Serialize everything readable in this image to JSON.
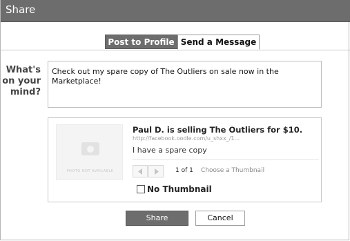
{
  "dialog": {
    "title": "Share"
  },
  "tabs": [
    {
      "label": "Post to Profile",
      "active": true
    },
    {
      "label": "Send a Message",
      "active": false
    }
  ],
  "status": {
    "prompt": "What's on your mind?",
    "text": "Check out my spare copy of The Outliers on sale now in the Marketplace!"
  },
  "attachment": {
    "thumbnail_placeholder": "PHOTO NOT AVAILABLE",
    "title": "Paul D. is selling The Outliers for $10.",
    "url": "http://facebook.oodle.com/u_shxx_/1...",
    "description": "I have a spare copy",
    "pager": {
      "count": "1 of 1",
      "choose_label": "Choose a Thumbnail",
      "prev_icon": "triangle-left",
      "next_icon": "triangle-right"
    },
    "no_thumbnail_label": "No Thumbnail",
    "no_thumbnail_checked": false
  },
  "actions": {
    "share_label": "Share",
    "cancel_label": "Cancel"
  },
  "colors": {
    "titlebar": "#6d6d6d",
    "active_tab": "#6d6d6d",
    "share_button": "#6d6d6d"
  }
}
